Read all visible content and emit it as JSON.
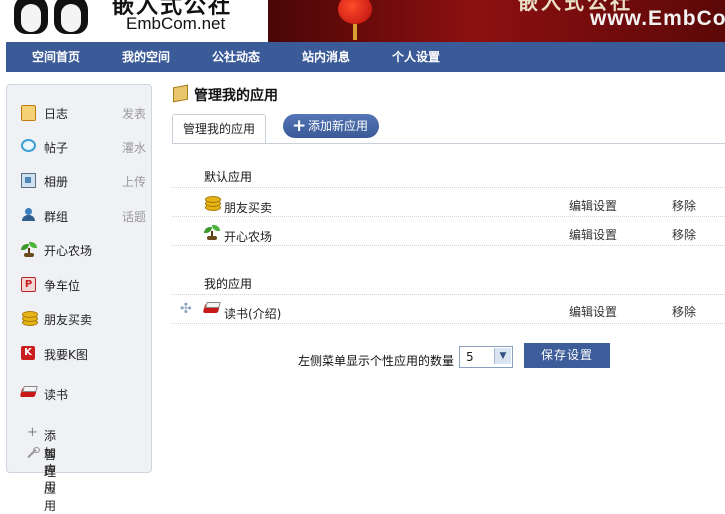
{
  "banner": {
    "logo_cn": "嵌入式公社",
    "logo_en": "EmbCom.net",
    "slogan_cn": "嵌入式公社",
    "site_url": "www.EmbCo",
    "colors": {
      "banner_red": "#8d1010",
      "nav_blue": "#3b5a98"
    }
  },
  "nav": {
    "items": [
      {
        "label": "空间首页"
      },
      {
        "label": "我的空间"
      },
      {
        "label": "公社动态"
      },
      {
        "label": "站内消息"
      },
      {
        "label": "个人设置"
      }
    ]
  },
  "sidebar": {
    "items": [
      {
        "label": "日志",
        "action": "发表",
        "icon": "diary-icon"
      },
      {
        "label": "帖子",
        "action": "灌水",
        "icon": "chat-bubble-icon"
      },
      {
        "label": "相册",
        "action": "上传",
        "icon": "photo-icon"
      },
      {
        "label": "群组",
        "action": "话题",
        "icon": "group-icon"
      },
      {
        "label": "开心农场",
        "action": "",
        "icon": "sprout-icon"
      },
      {
        "label": "争车位",
        "action": "",
        "icon": "parking-icon"
      },
      {
        "label": "朋友买卖",
        "action": "",
        "icon": "coins-icon"
      },
      {
        "label": "我要K图",
        "action": "",
        "icon": "k-icon"
      },
      {
        "label": "读书",
        "action": "",
        "icon": "book-icon"
      }
    ],
    "footer": [
      {
        "label": "添加应用",
        "icon": "plus-icon"
      },
      {
        "label": "管理应用",
        "icon": "wrench-icon"
      }
    ]
  },
  "main": {
    "title": "管理我的应用",
    "tab_label": "管理我的应用",
    "add_button": "添加新应用",
    "default_apps": {
      "heading": "默认应用",
      "rows": [
        {
          "name": "朋友买卖",
          "edit": "编辑设置",
          "remove": "移除",
          "icon": "coins-icon"
        },
        {
          "name": "开心农场",
          "edit": "编辑设置",
          "remove": "移除",
          "icon": "sprout-icon"
        }
      ]
    },
    "my_apps": {
      "heading": "我的应用",
      "rows": [
        {
          "name": "读书(介绍)",
          "edit": "编辑设置",
          "remove": "移除",
          "icon": "book-icon"
        }
      ]
    },
    "settings": {
      "label": "左侧菜单显示个性应用的数量",
      "select_value": "5",
      "save_button": "保存设置"
    }
  }
}
